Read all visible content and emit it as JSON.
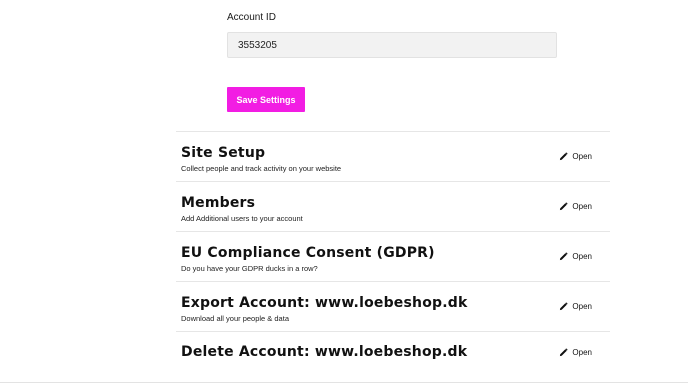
{
  "account": {
    "label": "Account ID",
    "value": "3553205"
  },
  "save_button": "Save Settings",
  "sections": [
    {
      "title": "Site Setup",
      "description": "Collect people and track activity on your website",
      "action": "Open"
    },
    {
      "title": "Members",
      "description": "Add Additional users to your account",
      "action": "Open"
    },
    {
      "title": "EU Compliance Consent (GDPR)",
      "description": "Do you have your GDPR ducks in a row?",
      "action": "Open"
    },
    {
      "title": "Export Account: www.loebeshop.dk",
      "description": "Download all your people & data",
      "action": "Open"
    },
    {
      "title": "Delete Account: www.loebeshop.dk",
      "description": "",
      "action": "Open"
    }
  ],
  "colors": {
    "accent": "#f21de3",
    "input_bg": "#f2f2f2",
    "divider": "#e6e6e6"
  },
  "icons": {
    "edit": "pencil-icon"
  }
}
